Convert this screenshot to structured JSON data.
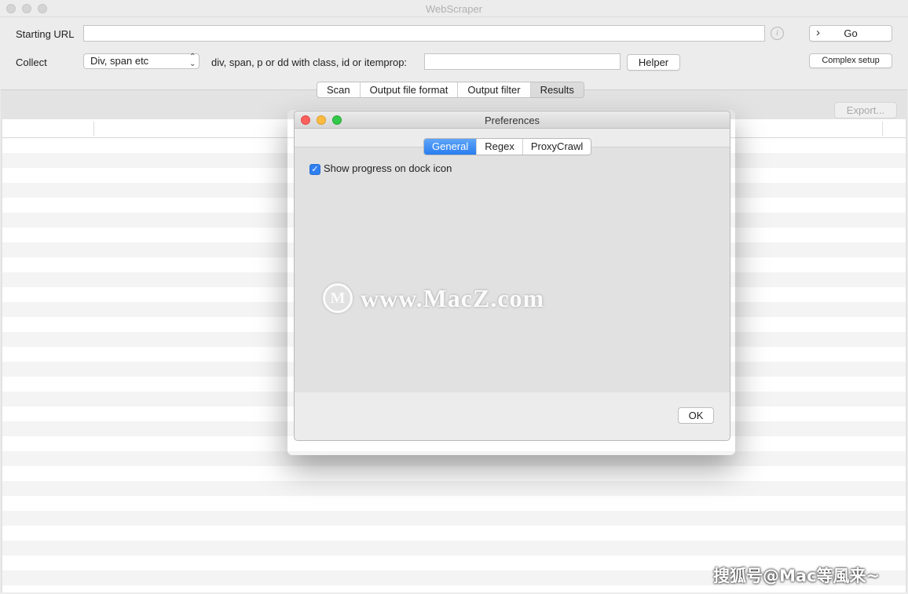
{
  "window": {
    "title": "WebScraper"
  },
  "form": {
    "starting_url_label": "Starting URL",
    "starting_url_value": "",
    "info_icon_glyph": "i",
    "go_label": "Go",
    "go_icon": "chevron-right-icon",
    "collect_label": "Collect",
    "collect_selected": "Div, span etc",
    "class_label": "div, span, p or dd with class, id or itemprop:",
    "class_value": "",
    "helper_label": "Helper",
    "complex_setup_label": "Complex setup"
  },
  "tabs": [
    {
      "label": "Scan",
      "selected": false
    },
    {
      "label": "Output file format",
      "selected": false
    },
    {
      "label": "Output filter",
      "selected": false
    },
    {
      "label": "Results",
      "selected": true
    }
  ],
  "results": {
    "export_label": "Export...",
    "export_enabled": false
  },
  "preferences": {
    "title": "Preferences",
    "tabs": [
      {
        "label": "General",
        "selected": true
      },
      {
        "label": "Regex",
        "selected": false
      },
      {
        "label": "ProxyCrawl",
        "selected": false
      }
    ],
    "show_progress_label": "Show progress on dock icon",
    "show_progress_checked": true,
    "ok_label": "OK"
  },
  "watermarks": {
    "center_logo_letter": "M",
    "center_text": "www.MacZ.com",
    "corner_text": "搜狐号@Mac等風来~"
  },
  "colors": {
    "accent": "#2f7ff0",
    "traffic_red": "#fc605c",
    "traffic_yellow": "#fdbc40",
    "traffic_green": "#34c84a",
    "window_bg": "#ececec"
  }
}
